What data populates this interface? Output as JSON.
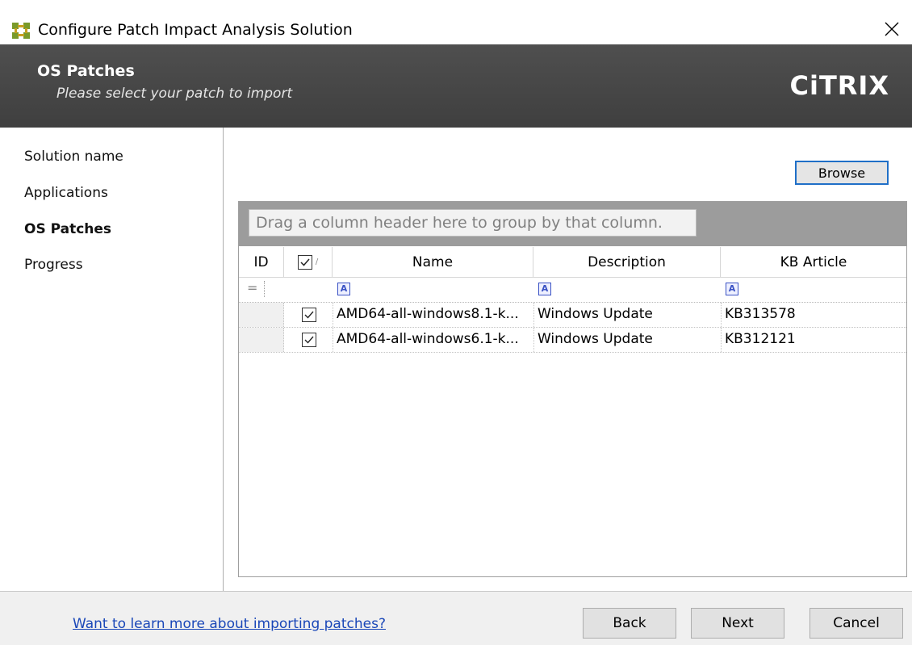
{
  "window": {
    "title": "Configure Patch Impact Analysis Solution"
  },
  "header": {
    "title": "OS Patches",
    "subtitle": "Please select your patch to import",
    "brand": "CiTRIX"
  },
  "sidebar": {
    "items": [
      {
        "label": "Solution name",
        "active": false
      },
      {
        "label": "Applications",
        "active": false
      },
      {
        "label": "OS Patches",
        "active": true
      },
      {
        "label": "Progress",
        "active": false
      }
    ]
  },
  "main": {
    "browse_label": "Browse",
    "grid": {
      "group_hint": "Drag a column header here to group by that column.",
      "columns": {
        "id": "ID",
        "name": "Name",
        "description": "Description",
        "kb": "KB Article"
      },
      "rows": [
        {
          "checked": true,
          "name": "AMD64-all-windows8.1-k...",
          "description": "Windows Update",
          "kb": "KB313578"
        },
        {
          "checked": true,
          "name": "AMD64-all-windows6.1-k...",
          "description": "Windows Update",
          "kb": "KB312121"
        }
      ]
    }
  },
  "footer": {
    "help_link": "Want to learn more about importing patches?",
    "back_label": "Back",
    "next_label": "Next",
    "cancel_label": "Cancel"
  },
  "colors": {
    "header_bg": "#444444",
    "accent": "#1f6fc7",
    "link": "#1a47b8"
  }
}
